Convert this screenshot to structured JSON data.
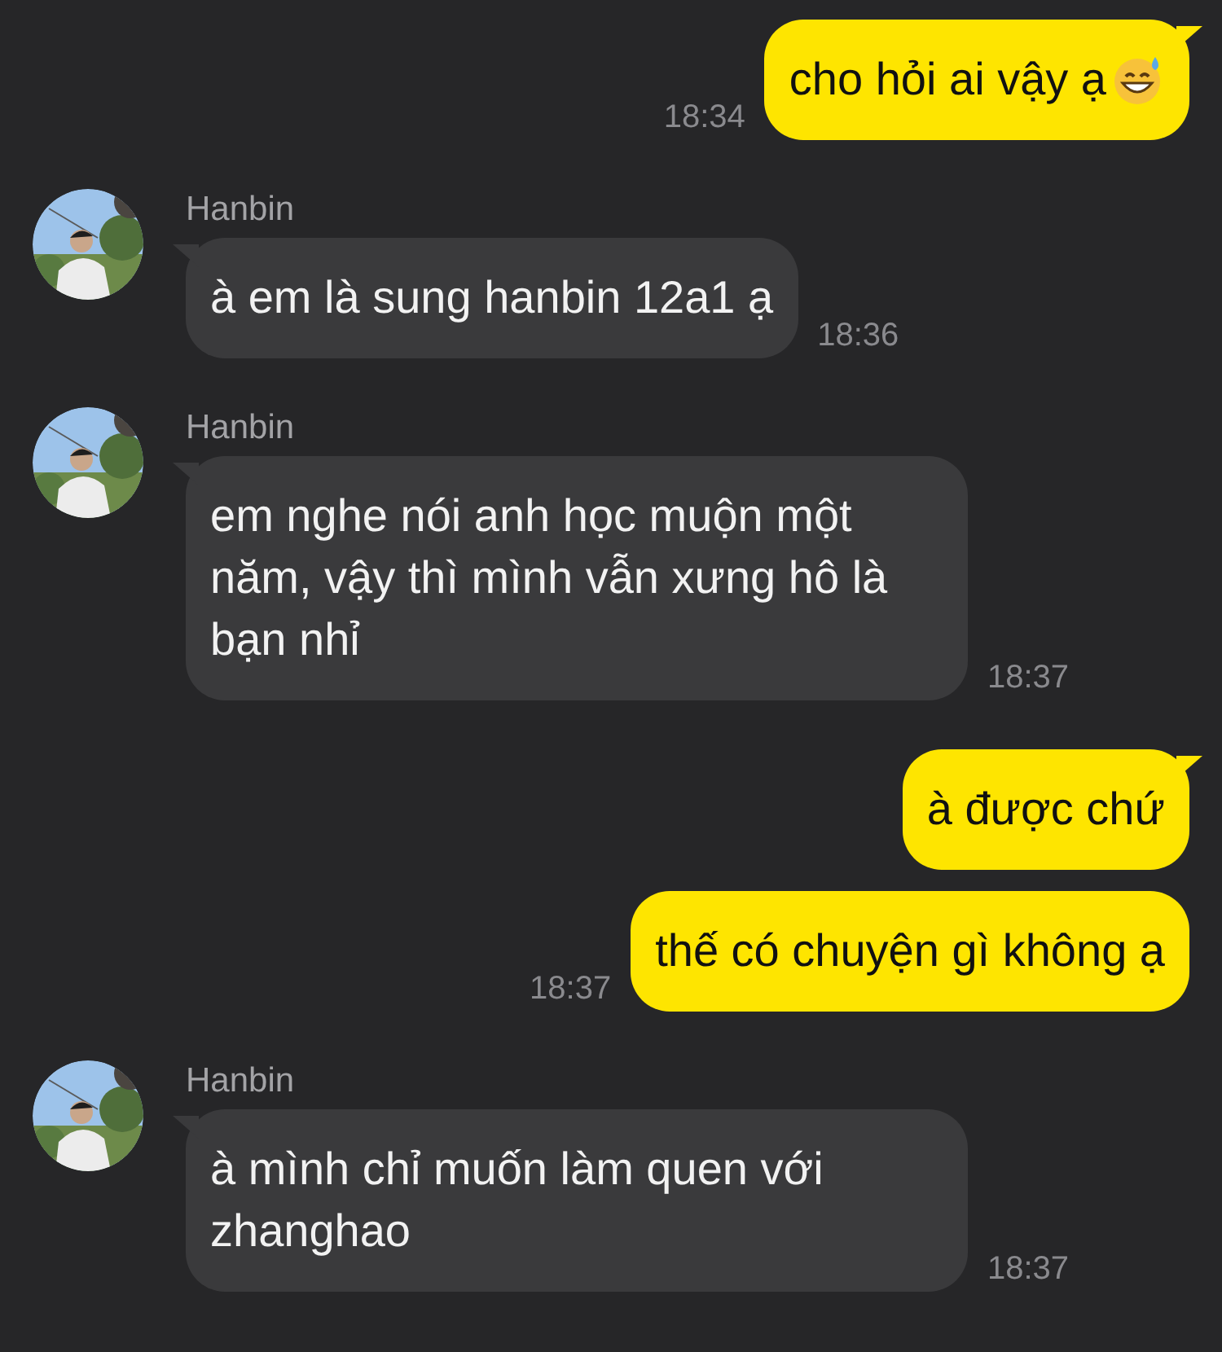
{
  "messages": [
    {
      "kind": "outgoing",
      "text": "cho hỏi ai vậy ạ",
      "trailing_emoji": true,
      "time": "18:34"
    },
    {
      "kind": "incoming",
      "name": "Hanbin",
      "text": "à em là sung hanbin 12a1 ạ",
      "time": "18:36"
    },
    {
      "kind": "incoming",
      "name": "Hanbin",
      "text": "em nghe nói anh học muộn một năm, vậy thì mình vẫn xưng hô là bạn nhỉ",
      "time": "18:37"
    },
    {
      "kind": "outgoing",
      "text": "à được chứ"
    },
    {
      "kind": "outgoing",
      "text": "thế có chuyện gì không ạ",
      "time": "18:37"
    },
    {
      "kind": "incoming",
      "name": "Hanbin",
      "text": "à mình chỉ muốn làm quen với zhanghao",
      "time": "18:37"
    }
  ]
}
